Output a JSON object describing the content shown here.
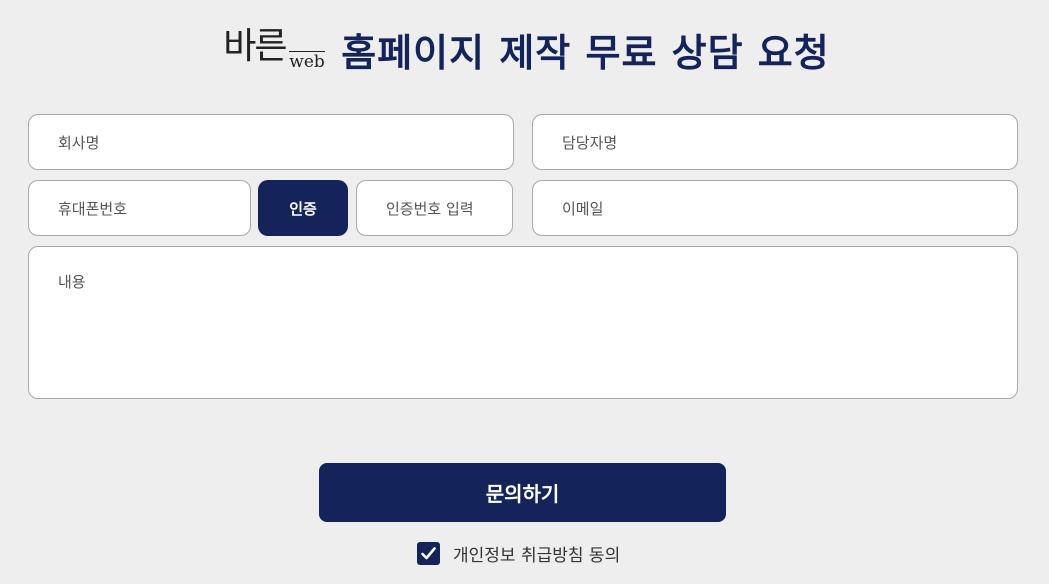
{
  "header": {
    "logo_main": "바른",
    "logo_web": "web",
    "title": "홈페이지 제작 무료 상담 요청"
  },
  "form": {
    "company_placeholder": "회사명",
    "manager_placeholder": "담당자명",
    "phone_placeholder": "휴대폰번호",
    "verify_label": "인증",
    "code_placeholder": "인증번호 입력",
    "email_placeholder": "이메일",
    "content_placeholder": "내용",
    "submit_label": "문의하기",
    "privacy_checked": true,
    "privacy_label": "개인정보 취급방침 동의"
  },
  "colors": {
    "accent": "#14245a",
    "background": "#eeeeef"
  },
  "icons": {
    "privacy_checkbox": "checkmark-icon"
  }
}
